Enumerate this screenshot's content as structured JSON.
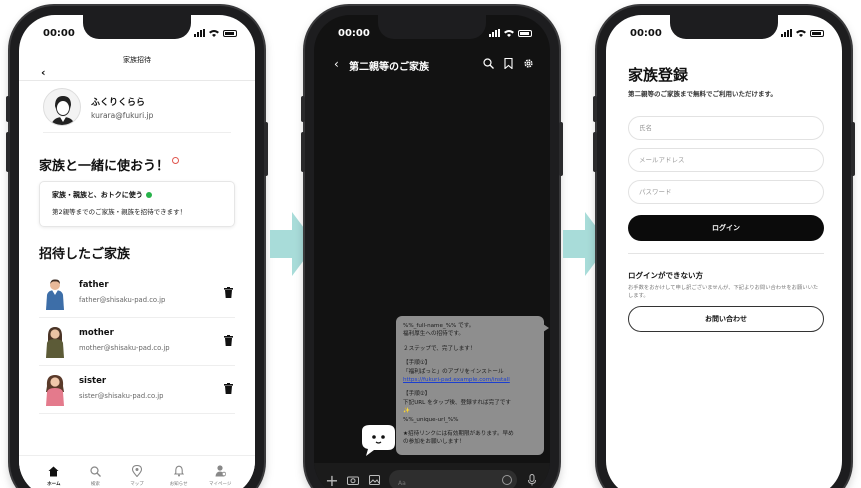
{
  "status_time": "00:00",
  "phone1": {
    "header_title": "家族招待",
    "profile": {
      "name": "ふくりくらら",
      "email": "kurara@fukuri.jp"
    },
    "use_together_heading": "家族と一緒に使おう！",
    "promo": {
      "line1": "家族・親族と、おトクに使う",
      "line2": "第2親等までのご家族・親族を招待できます！"
    },
    "invited_heading": "招待したご家族",
    "members": [
      {
        "name": "father",
        "email": "father@shisaku-pad.co.jp"
      },
      {
        "name": "mother",
        "email": "mother@shisaku-pad.co.jp"
      },
      {
        "name": "sister",
        "email": "sister@shisaku-pad.co.jp"
      }
    ],
    "tabs": [
      {
        "label": "ホーム",
        "icon": "home-icon"
      },
      {
        "label": "検索",
        "icon": "search-icon"
      },
      {
        "label": "マップ",
        "icon": "map-pin-icon"
      },
      {
        "label": "お知らせ",
        "icon": "bell-icon"
      },
      {
        "label": "マイページ",
        "icon": "user-icon"
      }
    ]
  },
  "phone2": {
    "chat_title": "第二親等のご家族",
    "message_lines": [
      "%%_full-name_%% です。",
      "福利厚生への招待です。",
      "",
      "２ステップで、完了します！",
      "",
      "【手順①】",
      "「福利ぱっと」のアプリをインストール",
      "https://fukuri-pad.example.com/install",
      "",
      "【手順②】",
      "下記URL をタップ後、登録すれば完了です",
      "✨",
      "%%_unique-url_%%",
      "",
      "★招待リンクには有効期限があります。早め",
      "の参加をお願いします！"
    ],
    "input_placeholder": "Aa"
  },
  "phone3": {
    "title": "家族登録",
    "subtitle": "第二親等のご家族まで無料でご利用いただけます。",
    "name_placeholder": "氏名",
    "email_placeholder": "メールアドレス",
    "password_placeholder": "パスワード",
    "login_label": "ログイン",
    "cant_login_heading": "ログインができない方",
    "cant_login_note": "お手数をおかけして申し訳ございませんが、下記よりお問い合わせをお願いいたします。",
    "contact_label": "お問い合わせ"
  },
  "colors": {
    "arrow": "#a8dcd9",
    "promo_dot": "#27b24a",
    "accent_dot": "#e0574f"
  }
}
